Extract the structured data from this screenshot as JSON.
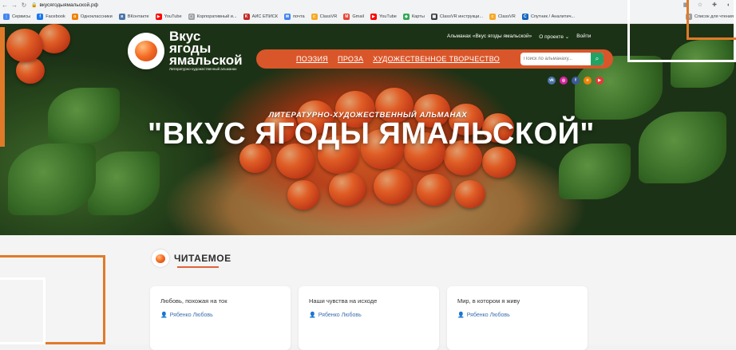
{
  "browser": {
    "url": "вкусягодыямальской.рф",
    "bookmarks": [
      {
        "label": "Сервисы",
        "color": "#4285f4",
        "glyph": "⋮"
      },
      {
        "label": "Facebook",
        "color": "#1877f2",
        "glyph": "f"
      },
      {
        "label": "Одноклассники",
        "color": "#ee8208",
        "glyph": "о"
      },
      {
        "label": "ВКонтакте",
        "color": "#4a76a8",
        "glyph": "в"
      },
      {
        "label": "YouTube",
        "color": "#ff0000",
        "glyph": "▶"
      },
      {
        "label": "Корпоративный и...",
        "color": "#9aa0a6",
        "glyph": "▢"
      },
      {
        "label": "АИС ЕПИСК",
        "color": "#c62828",
        "glyph": "K"
      },
      {
        "label": "почта",
        "color": "#4285f4",
        "glyph": "✉"
      },
      {
        "label": "ClassVR",
        "color": "#f9a825",
        "glyph": "c"
      },
      {
        "label": "Gmail",
        "color": "#ea4335",
        "glyph": "M"
      },
      {
        "label": "YouTube",
        "color": "#ff0000",
        "glyph": "▶"
      },
      {
        "label": "Карты",
        "color": "#34a853",
        "glyph": "◆"
      },
      {
        "label": "ClassVR инструкци...",
        "color": "#3c4043",
        "glyph": "▦"
      },
      {
        "label": "ClassVR",
        "color": "#f9a825",
        "glyph": "c"
      },
      {
        "label": "Спутник / Аналитич...",
        "color": "#1565c0",
        "glyph": "C"
      }
    ],
    "reading_list": "Список для чтения"
  },
  "site": {
    "logo_line1": "Вкус",
    "logo_line2": "ягоды",
    "logo_line3": "ямальской",
    "logo_sub": "Литературно-художественный альманах",
    "toplinks": {
      "about_almanac": "Альманах «Вкус ягоды ямальской»",
      "about_project": "О проекте",
      "login": "Войти"
    },
    "menu": [
      "ПОЭЗИЯ",
      "ПРОЗА",
      "ХУДОЖЕСТВЕННОЕ ТВОРЧЕСТВО"
    ],
    "search_placeholder": "Поиск по альманаху...",
    "socials": [
      {
        "name": "vk-icon",
        "color": "#4a76a8",
        "glyph": "vk"
      },
      {
        "name": "instagram-icon",
        "color": "#d6249f",
        "glyph": "◎"
      },
      {
        "name": "facebook-icon",
        "color": "#3b5998",
        "glyph": "f"
      },
      {
        "name": "odnoklassniki-icon",
        "color": "#ee8208",
        "glyph": "о"
      },
      {
        "name": "youtube-icon",
        "color": "#e53935",
        "glyph": "▶"
      }
    ],
    "subtitle": "ЛИТЕРАТУРНО-ХУДОЖЕСТВЕННЫЙ АЛЬМАНАХ",
    "title": "\"ВКУС ЯГОДЫ ЯМАЛЬСКОЙ\""
  },
  "section": {
    "title": "ЧИТАЕМОЕ",
    "cards": [
      {
        "title": "Любовь, похожая на ток",
        "author": "Рябенко Любовь"
      },
      {
        "title": "Наши чувства на исходе",
        "author": "Рябенко Любовь"
      },
      {
        "title": "Мир, в котором я живу",
        "author": "Рябенко Любовь"
      }
    ]
  },
  "colors": {
    "accent": "#d9562a",
    "frame": "#e07a28",
    "search_btn": "#21a366",
    "author_link": "#3f6fb0"
  }
}
